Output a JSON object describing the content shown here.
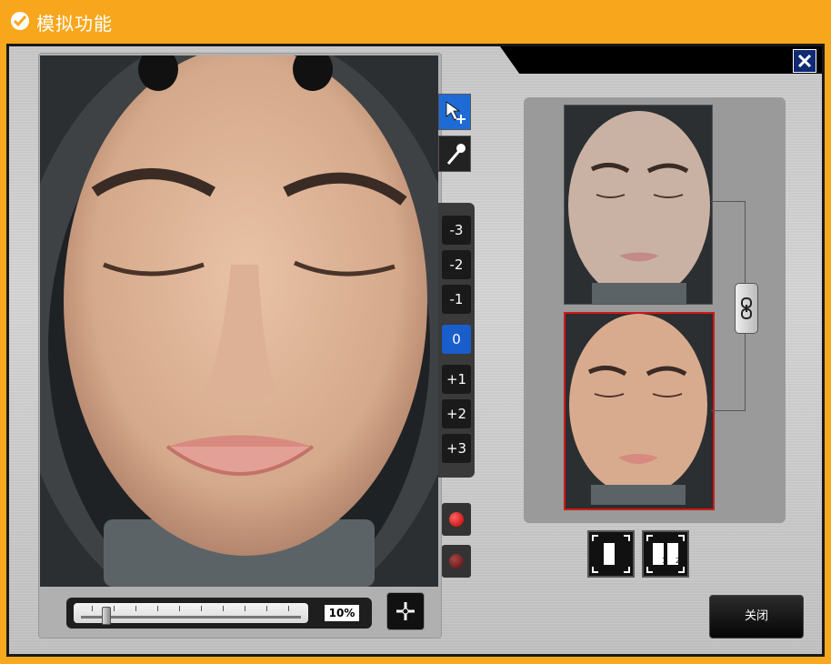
{
  "window": {
    "title": "模拟功能"
  },
  "zoom": {
    "value_label": "10%",
    "level_fraction": 0.1
  },
  "steps": [
    {
      "label": "-3",
      "active": false
    },
    {
      "label": "-2",
      "active": false
    },
    {
      "label": "-1",
      "active": false
    },
    {
      "label": "0",
      "active": true
    },
    {
      "label": "+1",
      "active": false
    },
    {
      "label": "+2",
      "active": false
    },
    {
      "label": "+3",
      "active": false
    }
  ],
  "layout_buttons": [
    {
      "name": "single-view",
      "digits": [
        "1"
      ]
    },
    {
      "name": "split-view",
      "digits": [
        "1",
        "2"
      ]
    }
  ],
  "footer": {
    "close_label": "关闭"
  },
  "colors": {
    "title_bar": "#F8A71C",
    "active_blue": "#1a5ecc",
    "selected_border": "#d01818"
  },
  "icons": [
    "check-circle-icon",
    "close-icon",
    "pointer-add-icon",
    "eyedropper-icon",
    "record-red-icon",
    "record-dark-icon",
    "crosshair-add-icon",
    "link-icon"
  ]
}
